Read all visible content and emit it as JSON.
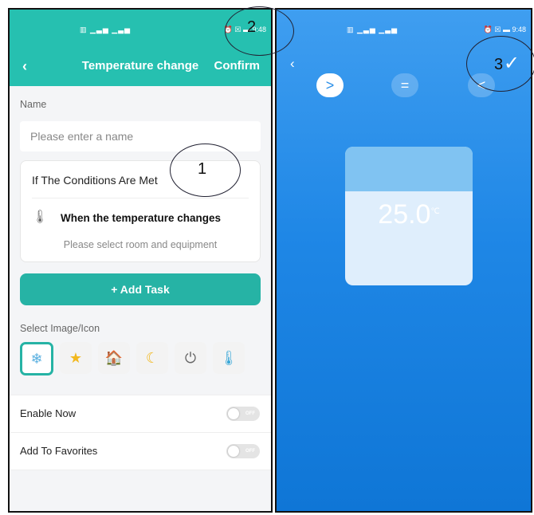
{
  "left_screen": {
    "status_bar": {
      "signal": "▥ ▁▃▅ ▁▃▅",
      "right": "⏰ ☒ ▬ 9:48"
    },
    "header": {
      "back": "‹",
      "title": "Temperature change",
      "confirm": "Confirm"
    },
    "name_section": {
      "label": "Name",
      "placeholder": "Please enter a name"
    },
    "condition_card": {
      "title": "If The Conditions Are Met",
      "condition_text": "When the temperature changes",
      "select_text": "Please select room and equipment",
      "thermometer_icon": "🌡"
    },
    "add_task_label": "+ Add Task",
    "image_section": {
      "label": "Select Image/Icon",
      "icons": [
        "❄",
        "★",
        "🏠",
        "☾",
        "⏻",
        "🌡"
      ]
    },
    "settings": [
      {
        "label": "Enable Now",
        "toggle": "OFF"
      },
      {
        "label": "Add To Favorites",
        "toggle": "OFF"
      }
    ]
  },
  "right_screen": {
    "status_bar": {
      "signal": "▥ ▁▃▅ ▁▃▅",
      "right": "⏰ ☒ ▬ 9:48"
    },
    "back": "‹",
    "check": "✓",
    "comparators": [
      ">",
      "=",
      "<"
    ],
    "selected_comparator": ">",
    "temperature": "25.0",
    "temperature_unit": "℃"
  },
  "annotations": [
    "1",
    "2",
    "3"
  ],
  "colors": {
    "accent": "#26b3a5",
    "header": "#26c0b0",
    "blue_bg": "#1f87e6"
  }
}
